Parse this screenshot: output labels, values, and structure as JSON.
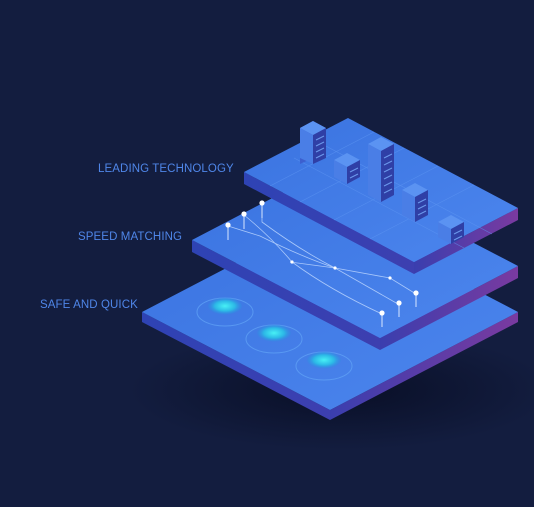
{
  "layers": {
    "top_label": "LEADING TECHNOLOGY",
    "middle_label": "SPEED MATCHING",
    "bottom_label": "SAFE AND QUICK"
  },
  "colors": {
    "background": "#131d3f",
    "label_text": "#4f86e8",
    "plate_top": "#3f78e4",
    "plate_side_front": "#3445b8",
    "plate_side_right": "#2a3aa8",
    "building": "#4a82ec",
    "pad_glow": "#33e0f0"
  }
}
